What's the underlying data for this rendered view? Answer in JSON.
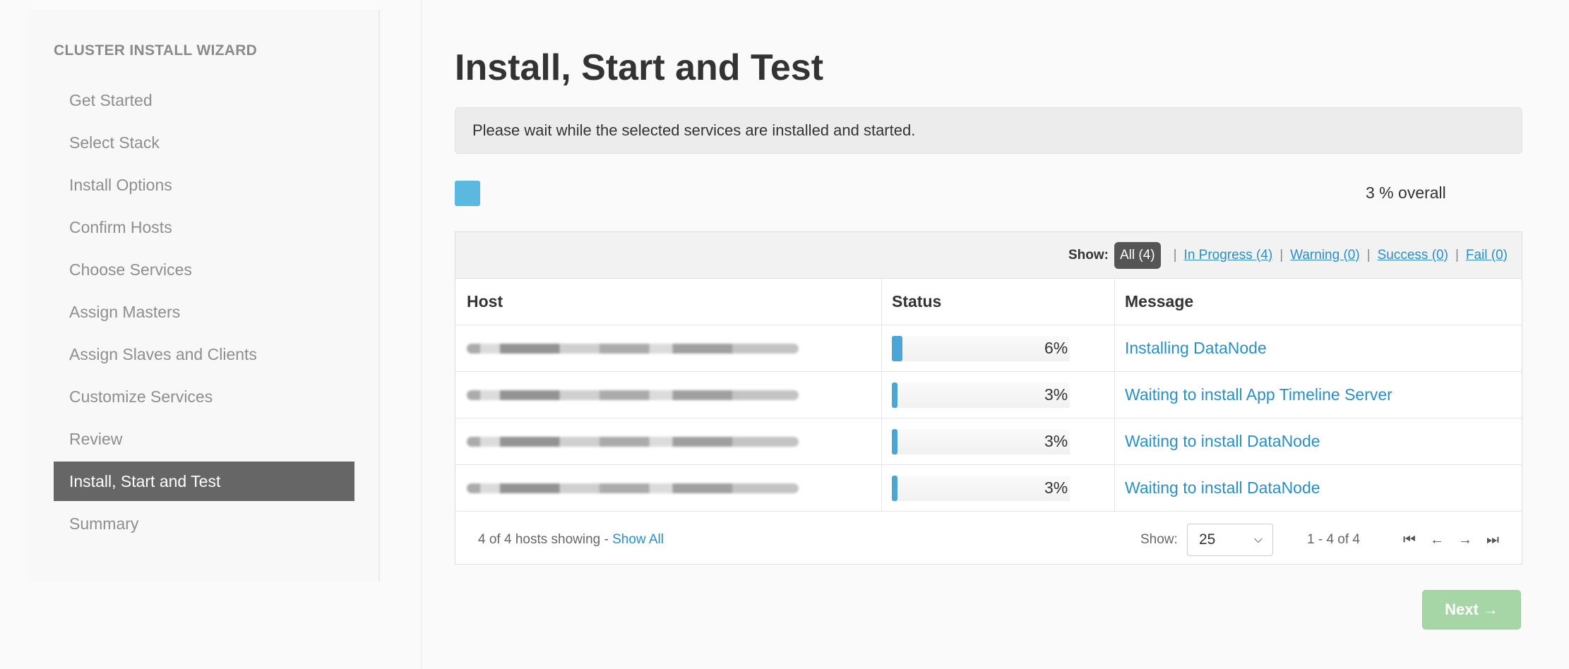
{
  "sidebar": {
    "title": "CLUSTER INSTALL WIZARD",
    "items": [
      {
        "label": "Get Started",
        "active": false
      },
      {
        "label": "Select Stack",
        "active": false
      },
      {
        "label": "Install Options",
        "active": false
      },
      {
        "label": "Confirm Hosts",
        "active": false
      },
      {
        "label": "Choose Services",
        "active": false
      },
      {
        "label": "Assign Masters",
        "active": false
      },
      {
        "label": "Assign Slaves and Clients",
        "active": false
      },
      {
        "label": "Customize Services",
        "active": false
      },
      {
        "label": "Review",
        "active": false
      },
      {
        "label": "Install, Start and Test",
        "active": true
      },
      {
        "label": "Summary",
        "active": false
      }
    ]
  },
  "main": {
    "title": "Install, Start and Test",
    "info": "Please wait while the selected services are installed and started.",
    "overall_progress": 0.03,
    "overall_label": "3 % overall"
  },
  "filters": {
    "show_label": "Show:",
    "all": "All (4)",
    "in_progress": "In Progress (4)",
    "warning": "Warning (0)",
    "success": "Success (0)",
    "fail": "Fail (0)",
    "separator": "|"
  },
  "table": {
    "headers": {
      "host": "Host",
      "status": "Status",
      "message": "Message"
    },
    "rows": [
      {
        "progress": 0.06,
        "percent": "6%",
        "message": "Installing DataNode"
      },
      {
        "progress": 0.03,
        "percent": "3%",
        "message": "Waiting to install App Timeline Server"
      },
      {
        "progress": 0.03,
        "percent": "3%",
        "message": "Waiting to install DataNode"
      },
      {
        "progress": 0.03,
        "percent": "3%",
        "message": "Waiting to install DataNode"
      }
    ]
  },
  "footer": {
    "hosts_showing": "4 of 4 hosts showing -",
    "show_all": "Show All",
    "show_label": "Show:",
    "page_size": "25",
    "range": "1 - 4 of 4",
    "first_icon": "⏮",
    "prev_icon": "←",
    "next_icon": "→",
    "last_icon": "⏭"
  },
  "next_button": "Next →",
  "colors": {
    "accent": "#2a8fc6",
    "progress": "#4aa6d6",
    "active_nav": "#666666",
    "next_button": "#a6d6a6"
  }
}
